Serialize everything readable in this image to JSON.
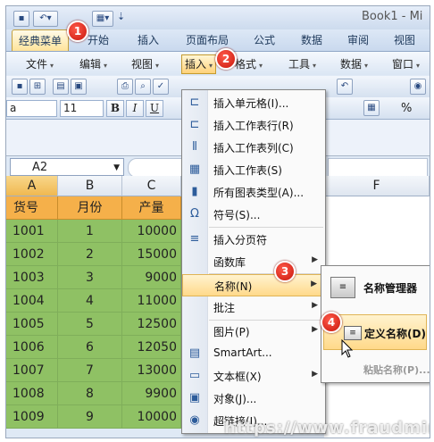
{
  "window": {
    "book_title": "Book1 - Mi"
  },
  "quick_access": {
    "icons": [
      "save-icon",
      "undo-icon",
      "view-icon"
    ]
  },
  "ribbon_tabs": [
    "经典菜单",
    "开始",
    "插入",
    "页面布局",
    "公式",
    "数据",
    "审阅",
    "视图"
  ],
  "classic_menu": [
    "文件",
    "编辑",
    "视图",
    "插入",
    "格式",
    "工具",
    "数据",
    "窗口"
  ],
  "font": {
    "name": "a",
    "size": "11",
    "bold": "B",
    "italic": "I",
    "underline": "U",
    "percent": "%"
  },
  "formula_bar": {
    "name_box": "A2"
  },
  "columns": [
    "A",
    "B",
    "C",
    "F"
  ],
  "sheet": {
    "headers": [
      "货号",
      "月份",
      "产量"
    ],
    "rows": [
      [
        "1001",
        "1",
        "10000"
      ],
      [
        "1002",
        "2",
        "15000"
      ],
      [
        "1003",
        "3",
        "9000"
      ],
      [
        "1004",
        "4",
        "11000"
      ],
      [
        "1005",
        "5",
        "12500"
      ],
      [
        "1006",
        "6",
        "12050"
      ],
      [
        "1007",
        "7",
        "13000"
      ],
      [
        "1008",
        "8",
        "9900"
      ],
      [
        "1009",
        "9",
        "10000"
      ]
    ]
  },
  "insert_menu": {
    "items": [
      {
        "label": "插入单元格(I)...",
        "icon": "insert-cells-icon"
      },
      {
        "label": "插入工作表行(R)",
        "icon": "insert-row-icon"
      },
      {
        "label": "插入工作表列(C)",
        "icon": "insert-column-icon"
      },
      {
        "label": "插入工作表(S)",
        "icon": "insert-sheet-icon"
      },
      {
        "label": "所有图表类型(A)...",
        "icon": "chart-icon"
      },
      {
        "label": "符号(S)...",
        "icon": "omega-icon"
      },
      {
        "label": "插入分页符",
        "icon": "page-break-icon"
      },
      {
        "label": "函数库",
        "icon": ""
      },
      {
        "label": "名称(N)",
        "icon": ""
      },
      {
        "label": "批注",
        "icon": ""
      },
      {
        "label": "图片(P)",
        "icon": ""
      },
      {
        "label": "SmartArt...",
        "icon": "smartart-icon"
      },
      {
        "label": "文本框(X)",
        "icon": "textbox-icon"
      },
      {
        "label": "对象(J)...",
        "icon": "object-icon"
      },
      {
        "label": "超链接(I)...",
        "icon": "hyperlink-icon"
      }
    ]
  },
  "name_submenu": {
    "items": [
      {
        "label": "名称管理器",
        "icon": "name-manager-icon"
      },
      {
        "label": "定义名称(D)",
        "icon": "define-name-icon"
      },
      {
        "label": "粘贴名称(P)...",
        "icon": ""
      }
    ]
  },
  "badges": [
    "1",
    "2",
    "3",
    "4"
  ],
  "watermark": "https://www.fraudmin.cc",
  "colors": {
    "header_fill": "#f5b04a",
    "data_fill": "#8fc164",
    "highlight": "#ffd98a",
    "badge": "#d9241a"
  }
}
